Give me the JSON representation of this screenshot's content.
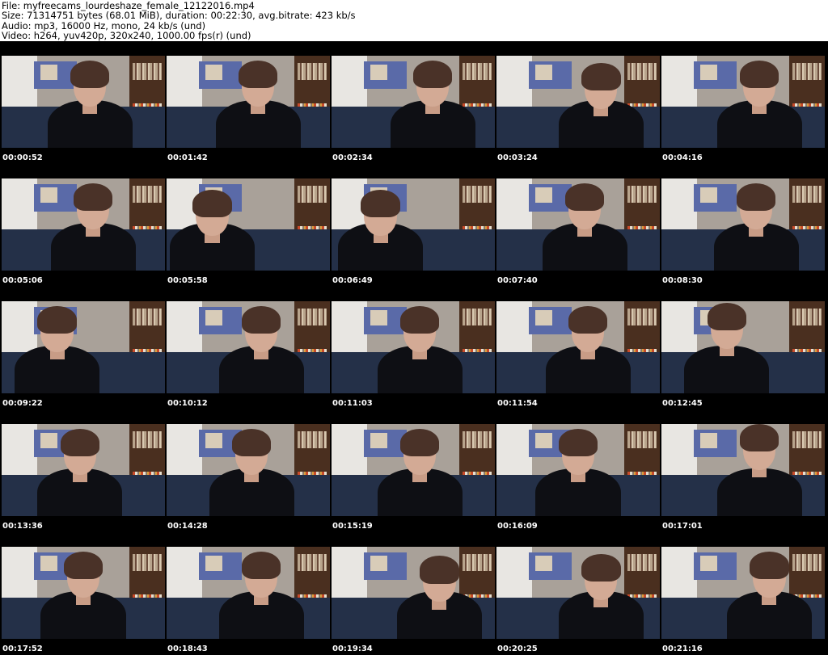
{
  "header": {
    "file_line": "File: myfreecams_lourdeshaze_female_12122016.mp4",
    "size_line": "Size: 71314751 bytes (68.01 MiB), duration: 00:22:30, avg.bitrate: 423 kb/s",
    "audio_line": "Audio: mp3, 16000 Hz, mono, 24 kb/s (und)",
    "video_line": "Video: h264, yuv420p, 320x240, 1000.00 fps(r) (und)"
  },
  "timestamps": [
    "00:00:52",
    "00:01:42",
    "00:02:34",
    "00:03:24",
    "00:04:16",
    "00:05:06",
    "00:05:58",
    "00:06:49",
    "00:07:40",
    "00:08:30",
    "00:09:22",
    "00:10:12",
    "00:11:03",
    "00:11:54",
    "00:12:45",
    "00:13:36",
    "00:14:28",
    "00:15:19",
    "00:16:09",
    "00:17:01",
    "00:17:52",
    "00:18:43",
    "00:19:34",
    "00:20:25",
    "00:21:16"
  ],
  "colors": {
    "sheet_background": "#000000",
    "header_background": "#ffffff",
    "timestamp_text": "#ffffff"
  }
}
